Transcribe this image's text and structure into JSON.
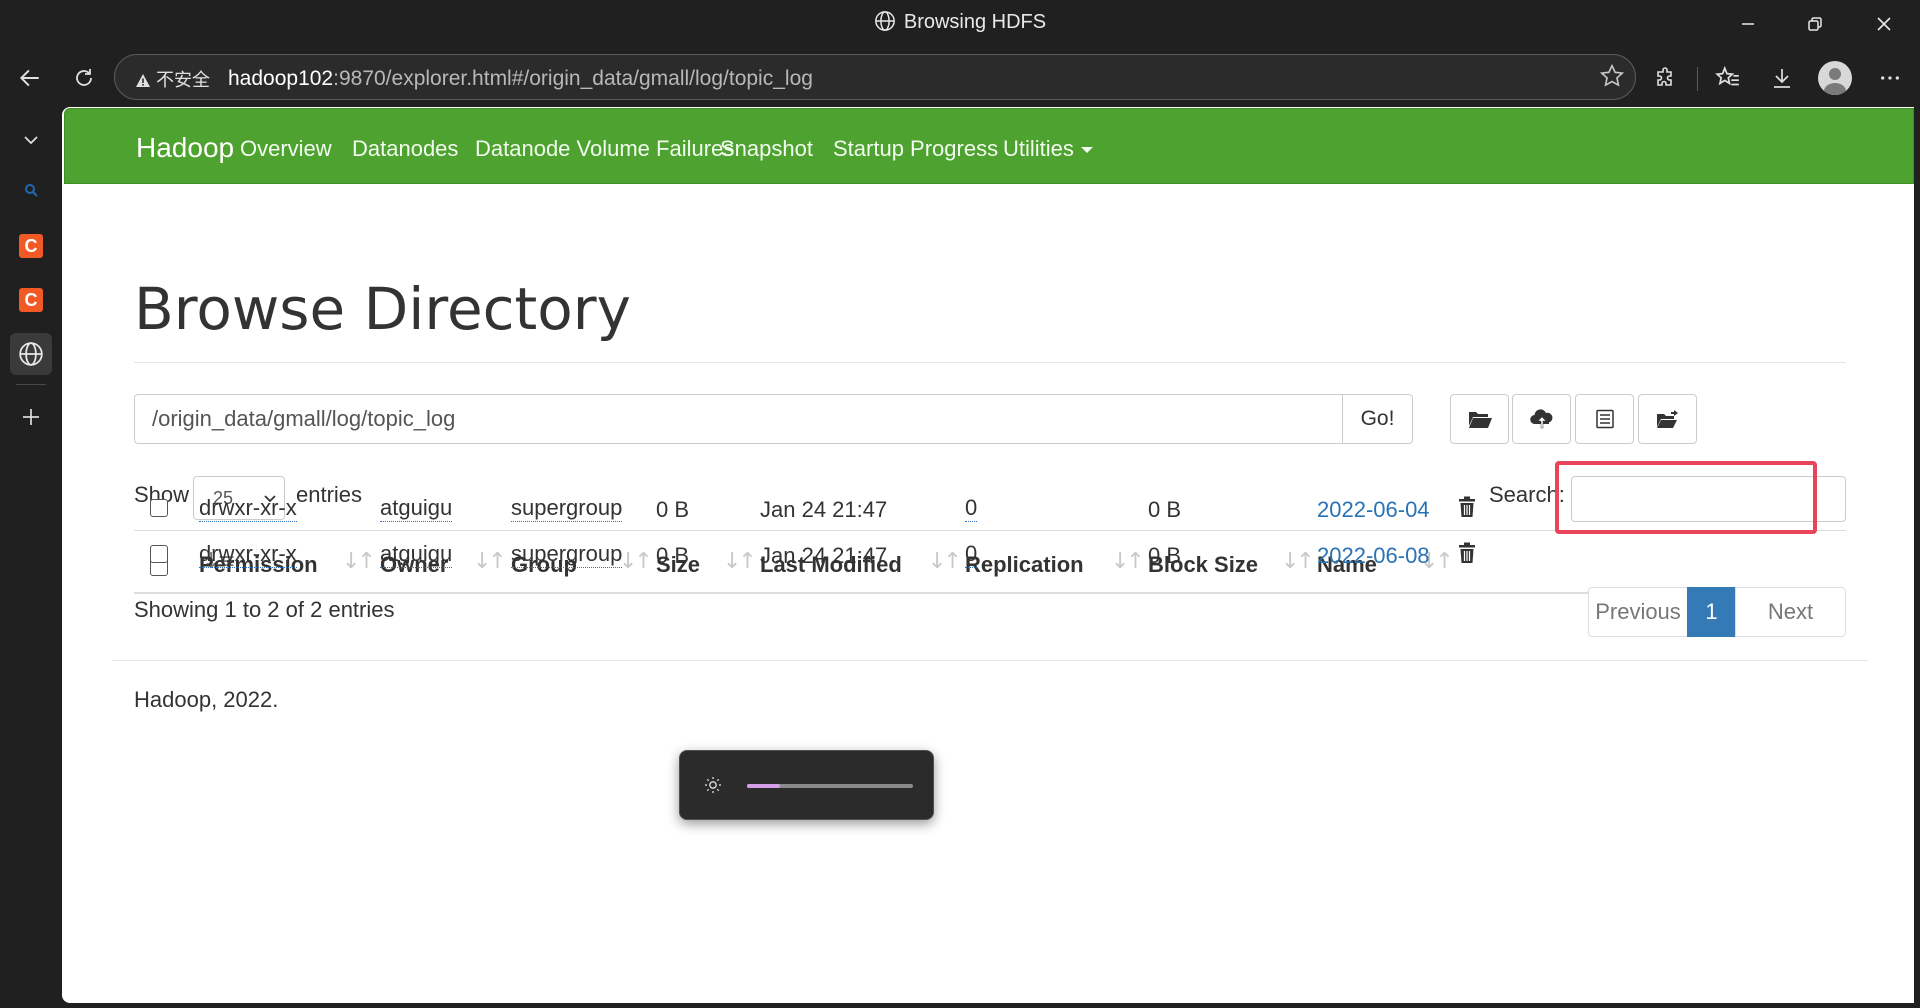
{
  "window": {
    "title": "Browsing HDFS"
  },
  "address_bar": {
    "security_label": "不安全",
    "host": "hadoop102",
    "rest": ":9870/explorer.html#/origin_data/gmall/log/topic_log"
  },
  "navbar": {
    "brand": "Hadoop",
    "links": [
      "Overview",
      "Datanodes",
      "Datanode Volume Failures",
      "Snapshot",
      "Startup Progress",
      "Utilities"
    ]
  },
  "page": {
    "title": "Browse Directory",
    "path_value": "/origin_data/gmall/log/topic_log",
    "go_label": "Go!",
    "show_label": "Show",
    "page_length": "25",
    "entries_label": "entries",
    "search_label": "Search:",
    "search_value": ""
  },
  "table": {
    "headers": [
      "Permission",
      "Owner",
      "Group",
      "Size",
      "Last Modified",
      "Replication",
      "Block Size",
      "Name"
    ],
    "rows": [
      {
        "permission": "drwxr-xr-x",
        "owner": "atguigu",
        "group": "supergroup",
        "size": "0 B",
        "modified": "Jan 24 21:47",
        "replication": "0",
        "block_size": "0 B",
        "name": "2022-06-04"
      },
      {
        "permission": "drwxr-xr-x",
        "owner": "atguigu",
        "group": "supergroup",
        "size": "0 B",
        "modified": "Jan 24 21:47",
        "replication": "0",
        "block_size": "0 B",
        "name": "2022-06-08"
      }
    ]
  },
  "pagination": {
    "info": "Showing 1 to 2 of 2 entries",
    "previous": "Previous",
    "current": "1",
    "next": "Next"
  },
  "footer": {
    "text": "Hadoop, 2022."
  },
  "brightness": {
    "level": 0.2
  },
  "colors": {
    "navbar_green": "#4ea22f",
    "link_blue": "#2a72b5",
    "highlight_red": "#e8445a",
    "pager_active": "#337ab7"
  }
}
